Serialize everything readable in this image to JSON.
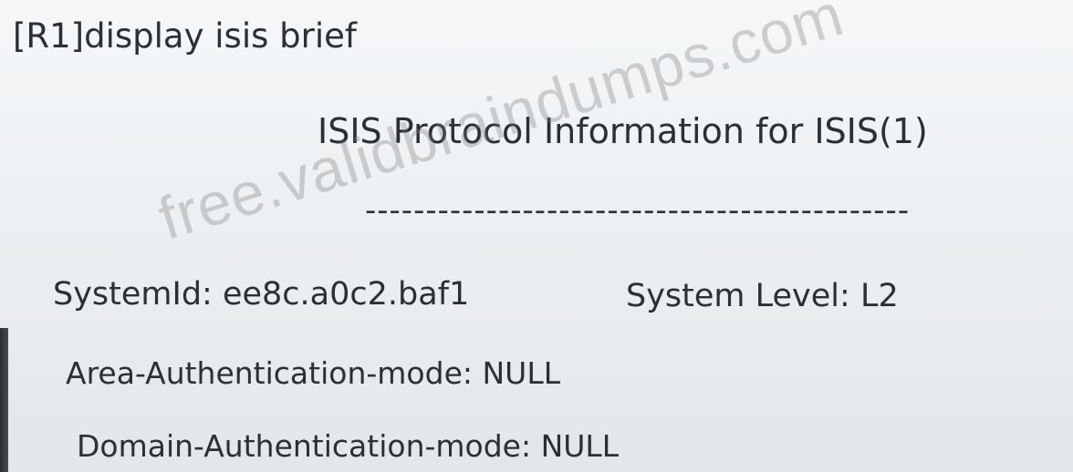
{
  "terminal": {
    "command_line": "[R1]display isis brief",
    "title": "ISIS Protocol Information for ISIS(1)",
    "separator": "---------------------------------------------",
    "system_id": "SystemId: ee8c.a0c2.baf1",
    "system_level": "System Level: L2",
    "area_auth_mode": "Area-Authentication-mode: NULL",
    "domain_auth_mode": "Domain-Authentication-mode: NULL"
  },
  "watermark": {
    "text": "free.validbraindumps.com"
  }
}
